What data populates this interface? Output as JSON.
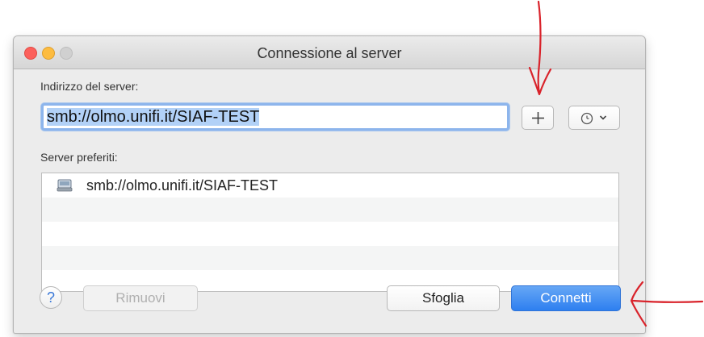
{
  "window": {
    "title": "Connessione al server"
  },
  "address": {
    "label": "Indirizzo del server:",
    "value": "smb://olmo.unifi.it/SIAF-TEST"
  },
  "toolbar": {
    "add_icon": "plus-icon",
    "history_icon": "clock-icon",
    "history_chevron": "chevron-down-icon"
  },
  "favorites": {
    "label": "Server preferiti:",
    "items": [
      {
        "label": "smb://olmo.unifi.it/SIAF-TEST",
        "icon": "network-drive-icon"
      }
    ]
  },
  "buttons": {
    "help": "?",
    "remove": "Rimuovi",
    "browse": "Sfoglia",
    "connect": "Connetti"
  },
  "colors": {
    "accent": "#2d7ff0",
    "annotation": "#d9232b",
    "selection": "#b2d1f7"
  }
}
